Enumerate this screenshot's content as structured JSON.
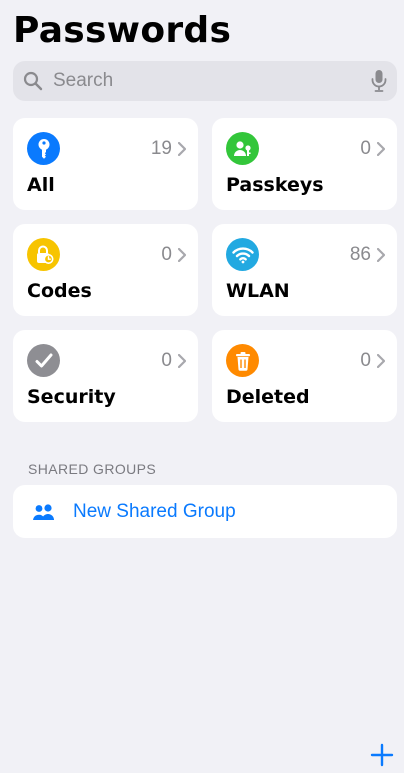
{
  "header": {
    "title": "Passwords"
  },
  "search": {
    "placeholder": "Search"
  },
  "categories": [
    {
      "label": "All",
      "count": "19",
      "icon": "key-icon",
      "color": "#0a7afe"
    },
    {
      "label": "Passkeys",
      "count": "0",
      "icon": "person-key-icon",
      "color": "#33c63a"
    },
    {
      "label": "Codes",
      "count": "0",
      "icon": "lock-clock-icon",
      "color": "#f7c400"
    },
    {
      "label": "WLAN",
      "count": "86",
      "icon": "wifi-icon",
      "color": "#22a9e1"
    },
    {
      "label": "Security",
      "count": "0",
      "icon": "checkmark-icon",
      "color": "#8e8e93"
    },
    {
      "label": "Deleted",
      "count": "0",
      "icon": "trash-icon",
      "color": "#ff8a00"
    }
  ],
  "shared": {
    "header": "SHARED GROUPS",
    "new_group_label": "New Shared Group"
  },
  "colors": {
    "accent": "#0a7afe",
    "background": "#f1f1f6"
  }
}
